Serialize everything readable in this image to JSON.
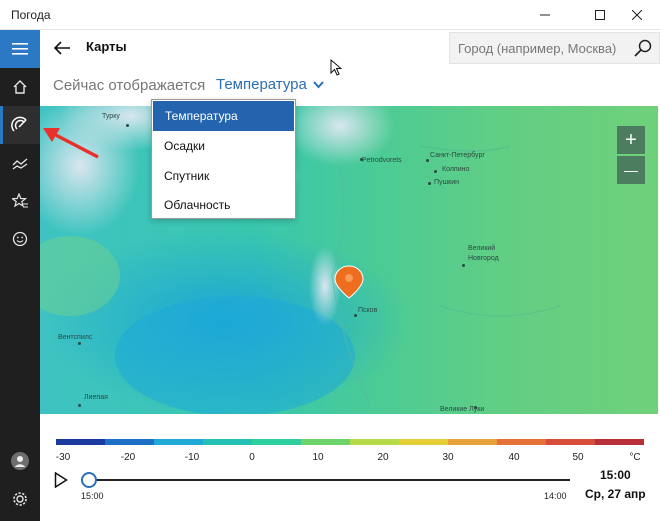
{
  "window": {
    "title": "Погода"
  },
  "header": {
    "page_title": "Карты"
  },
  "search": {
    "placeholder": "Город (например, Москва)"
  },
  "layer": {
    "showing_label": "Сейчас отображается",
    "selected": "Температура"
  },
  "dropdown": {
    "options": [
      "Температура",
      "Осадки",
      "Спутник",
      "Облачность"
    ]
  },
  "map": {
    "cities": [
      {
        "name": "Турку"
      },
      {
        "name": "Petrodvorets"
      },
      {
        "name": "Санкт-Петербург"
      },
      {
        "name": "Колпино"
      },
      {
        "name": "Пушкин"
      },
      {
        "name": "Великий Новгород",
        "line1": "Великий",
        "line2": "Новгород"
      },
      {
        "name": "Псков"
      },
      {
        "name": "Вентспилс"
      },
      {
        "name": "Лиепая"
      },
      {
        "name": "Великие Луки"
      }
    ],
    "zoom_in": "+",
    "zoom_out": "—"
  },
  "legend": {
    "colors": [
      "#1b3a9e",
      "#1e6fc6",
      "#20a8d6",
      "#24c1b4",
      "#2ecf9e",
      "#6fd36b",
      "#b8d94a",
      "#e6cf36",
      "#e8a23a",
      "#e5713a",
      "#d84d3a",
      "#b82f3a"
    ],
    "labels": [
      "-30",
      "-20",
      "-10",
      "0",
      "10",
      "20",
      "30",
      "40",
      "50",
      "°C"
    ]
  },
  "timeline": {
    "start": "15:00",
    "end": "14:00",
    "current_time": "15:00",
    "current_date": "Ср, 27 апр",
    "progress": 0.0
  }
}
